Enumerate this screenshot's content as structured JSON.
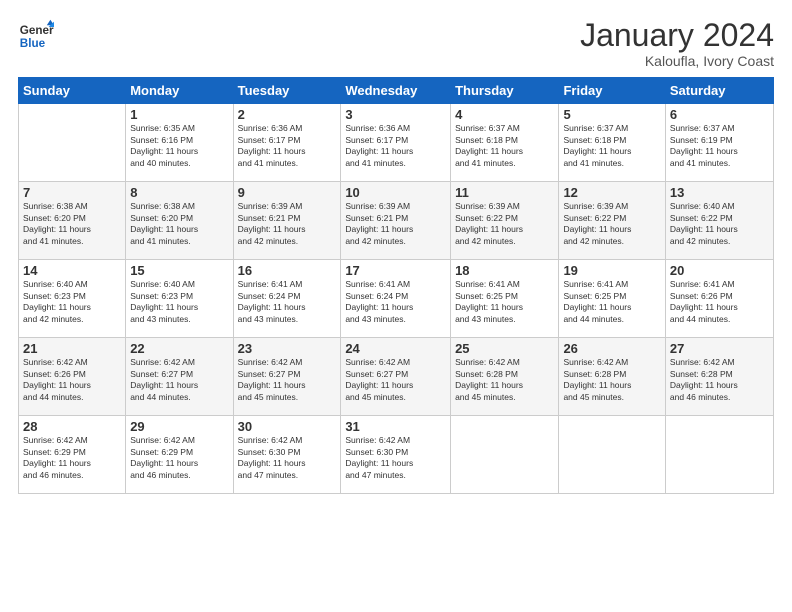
{
  "header": {
    "logo_line1": "General",
    "logo_line2": "Blue",
    "month": "January 2024",
    "location": "Kaloufla, Ivory Coast"
  },
  "weekdays": [
    "Sunday",
    "Monday",
    "Tuesday",
    "Wednesday",
    "Thursday",
    "Friday",
    "Saturday"
  ],
  "weeks": [
    [
      {
        "day": "",
        "info": ""
      },
      {
        "day": "1",
        "info": "Sunrise: 6:35 AM\nSunset: 6:16 PM\nDaylight: 11 hours\nand 40 minutes."
      },
      {
        "day": "2",
        "info": "Sunrise: 6:36 AM\nSunset: 6:17 PM\nDaylight: 11 hours\nand 41 minutes."
      },
      {
        "day": "3",
        "info": "Sunrise: 6:36 AM\nSunset: 6:17 PM\nDaylight: 11 hours\nand 41 minutes."
      },
      {
        "day": "4",
        "info": "Sunrise: 6:37 AM\nSunset: 6:18 PM\nDaylight: 11 hours\nand 41 minutes."
      },
      {
        "day": "5",
        "info": "Sunrise: 6:37 AM\nSunset: 6:18 PM\nDaylight: 11 hours\nand 41 minutes."
      },
      {
        "day": "6",
        "info": "Sunrise: 6:37 AM\nSunset: 6:19 PM\nDaylight: 11 hours\nand 41 minutes."
      }
    ],
    [
      {
        "day": "7",
        "info": "Sunrise: 6:38 AM\nSunset: 6:20 PM\nDaylight: 11 hours\nand 41 minutes."
      },
      {
        "day": "8",
        "info": "Sunrise: 6:38 AM\nSunset: 6:20 PM\nDaylight: 11 hours\nand 41 minutes."
      },
      {
        "day": "9",
        "info": "Sunrise: 6:39 AM\nSunset: 6:21 PM\nDaylight: 11 hours\nand 42 minutes."
      },
      {
        "day": "10",
        "info": "Sunrise: 6:39 AM\nSunset: 6:21 PM\nDaylight: 11 hours\nand 42 minutes."
      },
      {
        "day": "11",
        "info": "Sunrise: 6:39 AM\nSunset: 6:22 PM\nDaylight: 11 hours\nand 42 minutes."
      },
      {
        "day": "12",
        "info": "Sunrise: 6:39 AM\nSunset: 6:22 PM\nDaylight: 11 hours\nand 42 minutes."
      },
      {
        "day": "13",
        "info": "Sunrise: 6:40 AM\nSunset: 6:22 PM\nDaylight: 11 hours\nand 42 minutes."
      }
    ],
    [
      {
        "day": "14",
        "info": "Sunrise: 6:40 AM\nSunset: 6:23 PM\nDaylight: 11 hours\nand 42 minutes."
      },
      {
        "day": "15",
        "info": "Sunrise: 6:40 AM\nSunset: 6:23 PM\nDaylight: 11 hours\nand 43 minutes."
      },
      {
        "day": "16",
        "info": "Sunrise: 6:41 AM\nSunset: 6:24 PM\nDaylight: 11 hours\nand 43 minutes."
      },
      {
        "day": "17",
        "info": "Sunrise: 6:41 AM\nSunset: 6:24 PM\nDaylight: 11 hours\nand 43 minutes."
      },
      {
        "day": "18",
        "info": "Sunrise: 6:41 AM\nSunset: 6:25 PM\nDaylight: 11 hours\nand 43 minutes."
      },
      {
        "day": "19",
        "info": "Sunrise: 6:41 AM\nSunset: 6:25 PM\nDaylight: 11 hours\nand 44 minutes."
      },
      {
        "day": "20",
        "info": "Sunrise: 6:41 AM\nSunset: 6:26 PM\nDaylight: 11 hours\nand 44 minutes."
      }
    ],
    [
      {
        "day": "21",
        "info": "Sunrise: 6:42 AM\nSunset: 6:26 PM\nDaylight: 11 hours\nand 44 minutes."
      },
      {
        "day": "22",
        "info": "Sunrise: 6:42 AM\nSunset: 6:27 PM\nDaylight: 11 hours\nand 44 minutes."
      },
      {
        "day": "23",
        "info": "Sunrise: 6:42 AM\nSunset: 6:27 PM\nDaylight: 11 hours\nand 45 minutes."
      },
      {
        "day": "24",
        "info": "Sunrise: 6:42 AM\nSunset: 6:27 PM\nDaylight: 11 hours\nand 45 minutes."
      },
      {
        "day": "25",
        "info": "Sunrise: 6:42 AM\nSunset: 6:28 PM\nDaylight: 11 hours\nand 45 minutes."
      },
      {
        "day": "26",
        "info": "Sunrise: 6:42 AM\nSunset: 6:28 PM\nDaylight: 11 hours\nand 45 minutes."
      },
      {
        "day": "27",
        "info": "Sunrise: 6:42 AM\nSunset: 6:28 PM\nDaylight: 11 hours\nand 46 minutes."
      }
    ],
    [
      {
        "day": "28",
        "info": "Sunrise: 6:42 AM\nSunset: 6:29 PM\nDaylight: 11 hours\nand 46 minutes."
      },
      {
        "day": "29",
        "info": "Sunrise: 6:42 AM\nSunset: 6:29 PM\nDaylight: 11 hours\nand 46 minutes."
      },
      {
        "day": "30",
        "info": "Sunrise: 6:42 AM\nSunset: 6:30 PM\nDaylight: 11 hours\nand 47 minutes."
      },
      {
        "day": "31",
        "info": "Sunrise: 6:42 AM\nSunset: 6:30 PM\nDaylight: 11 hours\nand 47 minutes."
      },
      {
        "day": "",
        "info": ""
      },
      {
        "day": "",
        "info": ""
      },
      {
        "day": "",
        "info": ""
      }
    ]
  ]
}
